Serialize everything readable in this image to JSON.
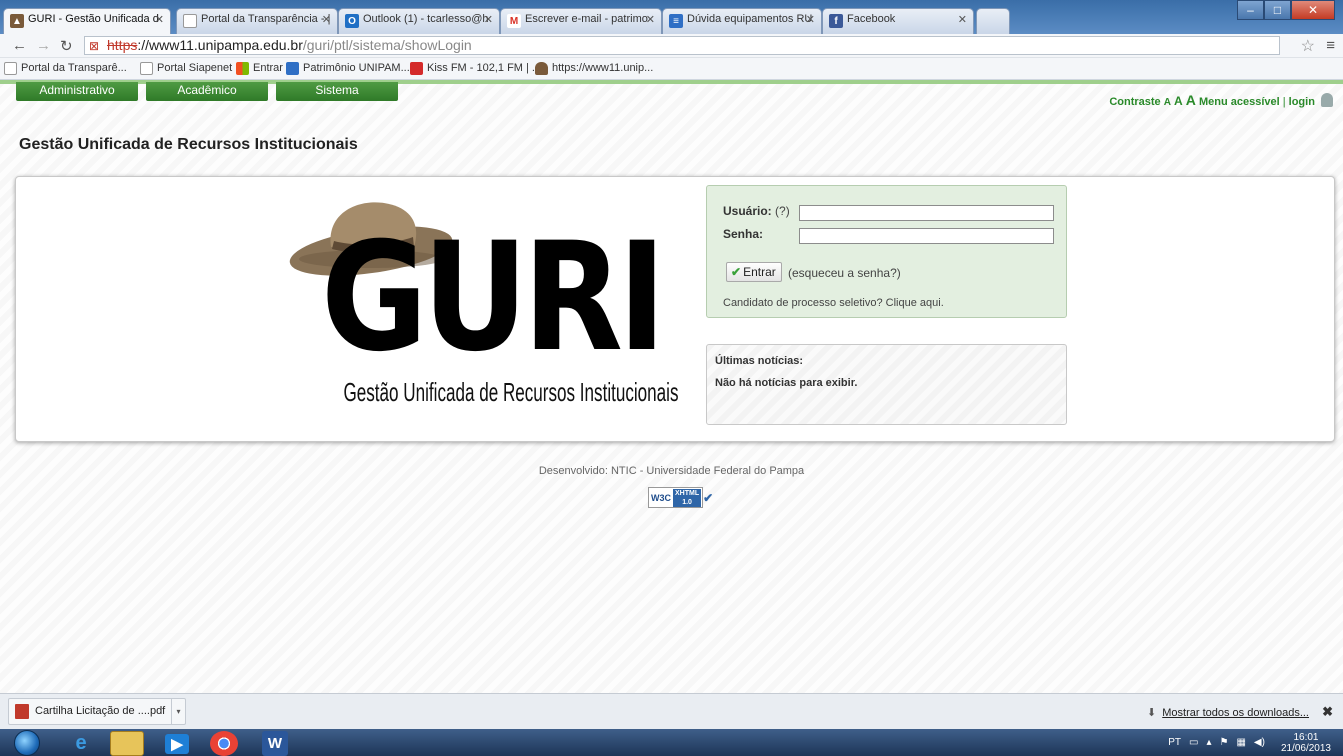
{
  "browser": {
    "tabs": [
      {
        "title": "GURI - Gestão Unificada d",
        "active": true,
        "icon": "hat-icon",
        "color": "#7a5a3a"
      },
      {
        "title": "Portal da Transparência - |",
        "active": false,
        "icon": "page-icon",
        "color": "#ffffff"
      },
      {
        "title": "Outlook (1) - tcarlesso@h",
        "active": false,
        "icon": "outlook-icon",
        "color": "#1f6fc5"
      },
      {
        "title": "Escrever e-mail - patrimo",
        "active": false,
        "icon": "gmail-icon",
        "color": "#d93025"
      },
      {
        "title": "Dúvida equipamentos RU",
        "active": false,
        "icon": "doc-icon",
        "color": "#2f6fc5"
      },
      {
        "title": "Facebook",
        "active": false,
        "icon": "facebook-icon",
        "color": "#3b5998"
      }
    ],
    "url": {
      "scheme": "https",
      "rest": "://www11.unipampa.edu.br",
      "path": "/guri/ptl/sistema/showLogin"
    },
    "bookmarks": [
      {
        "label": "Portal da Transparê...",
        "icon": "page-icon"
      },
      {
        "label": "Portal Siapenet",
        "icon": "page-icon"
      },
      {
        "label": "Entrar",
        "icon": "windows-icon"
      },
      {
        "label": "Patrimônio UNIPAM...",
        "icon": "doc-icon"
      },
      {
        "label": "Kiss FM - 102,1 FM | ...",
        "icon": "radio-icon"
      },
      {
        "label": "https://www11.unip...",
        "icon": "hat-icon"
      }
    ]
  },
  "topnav": {
    "menus": [
      "Administrativo",
      "Acadêmico",
      "Sistema"
    ],
    "accessibility": {
      "contrast": "Contraste",
      "font_small": "A",
      "font_medium": "A",
      "font_large": "A",
      "menu": "Menu acessível",
      "separator": "|",
      "login": "login"
    }
  },
  "page": {
    "title": "Gestão Unificada de Recursos Institucionais",
    "logo": {
      "wordmark": "GURI",
      "subtitle": "Gestão Unificada de Recursos Institucionais"
    }
  },
  "login": {
    "user_label": "Usuário:",
    "user_hint": "(?)",
    "user_value": "",
    "password_label": "Senha:",
    "password_value": "",
    "submit_label": "Entrar",
    "forgot_label": "(esqueceu a senha?)",
    "candidate_label": "Candidato de processo seletivo? Clique aqui."
  },
  "news": {
    "title": "Últimas notícias:",
    "empty": "Não há notícias para exibir."
  },
  "footer": {
    "credit": "Desenvolvido: NTIC - Universidade Federal do Pampa",
    "badge_w3c": "W3C",
    "badge_line1": "XHTML",
    "badge_line2": "1.0"
  },
  "downloads": {
    "file": "Cartilha Licitação de ....pdf",
    "show_all": "Mostrar todos os downloads...",
    "close": "✖"
  },
  "taskbar": {
    "lang": "PT",
    "time": "16:01",
    "date": "21/06/2013"
  }
}
